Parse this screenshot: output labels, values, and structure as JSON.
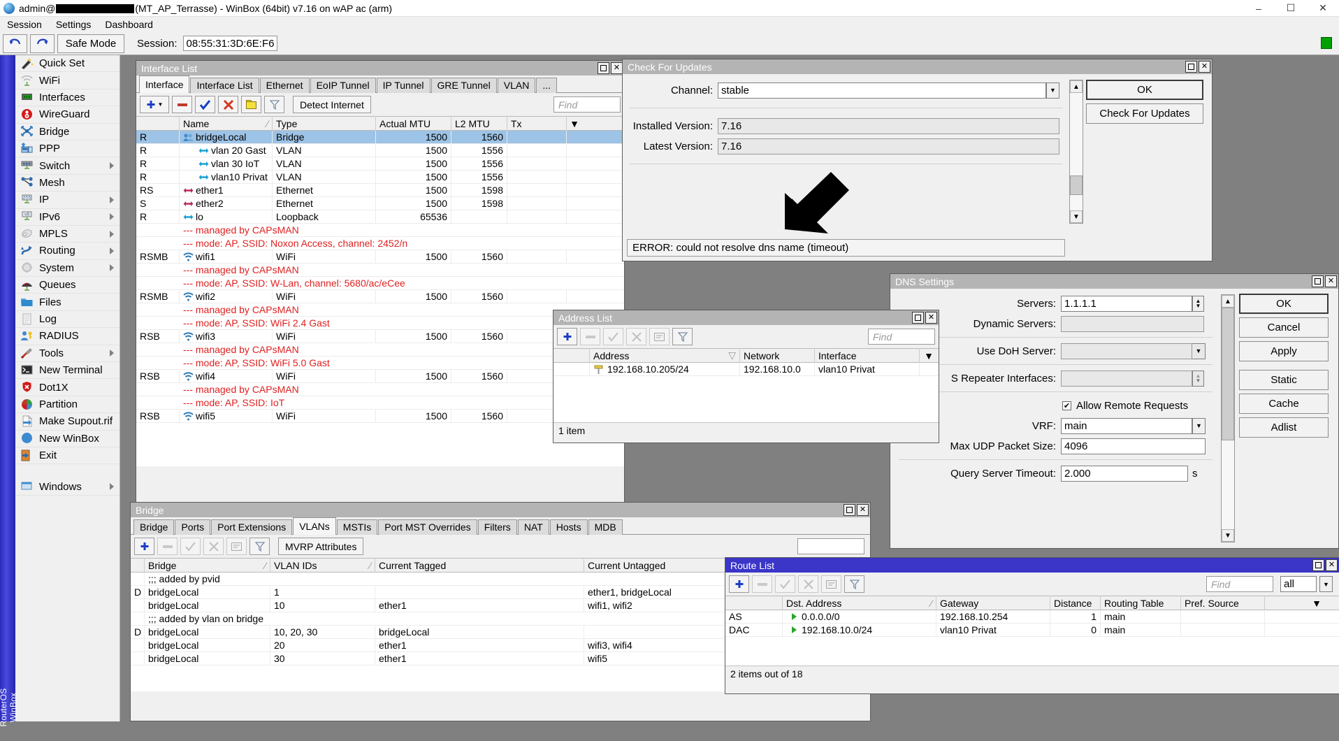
{
  "titlebar": {
    "prefix": "admin@",
    "suffix": "(MT_AP_Terrasse) - WinBox (64bit) v7.16 on wAP ac (arm)",
    "minimize": "–",
    "maximize": "☐",
    "close": "✕"
  },
  "menubar": {
    "items": [
      "Session",
      "Settings",
      "Dashboard"
    ]
  },
  "toolbar": {
    "undo": "↶",
    "redo": "↷",
    "safe_mode": "Safe Mode",
    "session_label": "Session:",
    "session_value": "08:55:31:3D:6E:F6"
  },
  "sidebar": {
    "vertical_label": "RouterOS WinBox",
    "items": [
      {
        "label": "Quick Set",
        "icon": "wand-icon",
        "arrow": false
      },
      {
        "label": "WiFi",
        "icon": "wifi-icon",
        "arrow": false
      },
      {
        "label": "Interfaces",
        "icon": "interfaces-icon",
        "arrow": false
      },
      {
        "label": "WireGuard",
        "icon": "wireguard-icon",
        "arrow": false
      },
      {
        "label": "Bridge",
        "icon": "bridge-icon",
        "arrow": false
      },
      {
        "label": "PPP",
        "icon": "ppp-icon",
        "arrow": false
      },
      {
        "label": "Switch",
        "icon": "switch-icon",
        "arrow": true
      },
      {
        "label": "Mesh",
        "icon": "mesh-icon",
        "arrow": false
      },
      {
        "label": "IP",
        "icon": "ip-icon",
        "arrow": true
      },
      {
        "label": "IPv6",
        "icon": "ipv6-icon",
        "arrow": true
      },
      {
        "label": "MPLS",
        "icon": "mpls-icon",
        "arrow": true
      },
      {
        "label": "Routing",
        "icon": "routing-icon",
        "arrow": true
      },
      {
        "label": "System",
        "icon": "system-icon",
        "arrow": true
      },
      {
        "label": "Queues",
        "icon": "queues-icon",
        "arrow": false
      },
      {
        "label": "Files",
        "icon": "files-icon",
        "arrow": false
      },
      {
        "label": "Log",
        "icon": "log-icon",
        "arrow": false
      },
      {
        "label": "RADIUS",
        "icon": "radius-icon",
        "arrow": false
      },
      {
        "label": "Tools",
        "icon": "tools-icon",
        "arrow": true
      },
      {
        "label": "New Terminal",
        "icon": "terminal-icon",
        "arrow": false
      },
      {
        "label": "Dot1X",
        "icon": "dot1x-icon",
        "arrow": false
      },
      {
        "label": "Partition",
        "icon": "partition-icon",
        "arrow": false
      },
      {
        "label": "Make Supout.rif",
        "icon": "supout-icon",
        "arrow": false
      },
      {
        "label": "New WinBox",
        "icon": "winbox-icon",
        "arrow": false
      },
      {
        "label": "Exit",
        "icon": "exit-icon",
        "arrow": false
      },
      {
        "label": "",
        "icon": "",
        "arrow": false
      },
      {
        "label": "Windows",
        "icon": "windows-icon",
        "arrow": true
      }
    ]
  },
  "interface_list": {
    "title": "Interface List",
    "tabs": [
      "Interface",
      "Interface List",
      "Ethernet",
      "EoIP Tunnel",
      "IP Tunnel",
      "GRE Tunnel",
      "VLAN",
      "..."
    ],
    "selected_tab": "Interface",
    "toolbar": {
      "add": "＋",
      "add_caret": "▾",
      "remove": "–",
      "enable": "✔",
      "disable": "✘",
      "comment": "▭",
      "filter": "∇",
      "detect": "Detect Internet"
    },
    "find_placeholder": "Find",
    "columns": [
      "",
      "Name",
      "Type",
      "Actual MTU",
      "L2 MTU",
      "Tx",
      ""
    ],
    "rows": [
      {
        "kind": "row",
        "flags": "R",
        "icon": "bridge-row-icon",
        "indent": 0,
        "name": "bridgeLocal",
        "type": "Bridge",
        "mtu": "1500",
        "l2mtu": "1560",
        "tx": "",
        "selected": true
      },
      {
        "kind": "row",
        "flags": "R",
        "icon": "vlan-row-icon",
        "indent": 1,
        "name": "vlan 20 Gast",
        "type": "VLAN",
        "mtu": "1500",
        "l2mtu": "1556",
        "tx": ""
      },
      {
        "kind": "row",
        "flags": "R",
        "icon": "vlan-row-icon",
        "indent": 1,
        "name": "vlan 30 IoT",
        "type": "VLAN",
        "mtu": "1500",
        "l2mtu": "1556",
        "tx": ""
      },
      {
        "kind": "row",
        "flags": "R",
        "icon": "vlan-row-icon",
        "indent": 1,
        "name": "vlan10 Privat",
        "type": "VLAN",
        "mtu": "1500",
        "l2mtu": "1556",
        "tx": ""
      },
      {
        "kind": "row",
        "flags": "RS",
        "icon": "ether-row-icon",
        "indent": 0,
        "name": "ether1",
        "type": "Ethernet",
        "mtu": "1500",
        "l2mtu": "1598",
        "tx": ""
      },
      {
        "kind": "row",
        "flags": "S",
        "icon": "ether-row-icon",
        "indent": 0,
        "name": "ether2",
        "type": "Ethernet",
        "mtu": "1500",
        "l2mtu": "1598",
        "tx": ""
      },
      {
        "kind": "row",
        "flags": "R",
        "icon": "vlan-row-icon",
        "indent": 0,
        "name": "lo",
        "type": "Loopback",
        "mtu": "65536",
        "l2mtu": "",
        "tx": ""
      },
      {
        "kind": "comment",
        "text": "--- managed by CAPsMAN"
      },
      {
        "kind": "comment",
        "text": "--- mode: AP, SSID: Noxon Access, channel: 2452/n"
      },
      {
        "kind": "row",
        "flags": "RSMB",
        "icon": "wifi-row-icon",
        "indent": 0,
        "name": "wifi1",
        "type": "WiFi",
        "mtu": "1500",
        "l2mtu": "1560",
        "tx": ""
      },
      {
        "kind": "comment",
        "text": "--- managed by CAPsMAN"
      },
      {
        "kind": "comment",
        "text": "--- mode: AP, SSID: W-Lan, channel: 5680/ac/eCee"
      },
      {
        "kind": "row",
        "flags": "RSMB",
        "icon": "wifi-row-icon",
        "indent": 0,
        "name": "wifi2",
        "type": "WiFi",
        "mtu": "1500",
        "l2mtu": "1560",
        "tx": ""
      },
      {
        "kind": "comment",
        "text": "--- managed by CAPsMAN"
      },
      {
        "kind": "comment",
        "text": "--- mode: AP, SSID: WiFi 2.4 Gast"
      },
      {
        "kind": "row",
        "flags": "RSB",
        "icon": "wifi-row-icon",
        "indent": 0,
        "name": "wifi3",
        "type": "WiFi",
        "mtu": "1500",
        "l2mtu": "1560",
        "tx": ""
      },
      {
        "kind": "comment",
        "text": "--- managed by CAPsMAN"
      },
      {
        "kind": "comment",
        "text": "--- mode: AP, SSID: WiFi 5.0 Gast"
      },
      {
        "kind": "row",
        "flags": "RSB",
        "icon": "wifi-row-icon",
        "indent": 0,
        "name": "wifi4",
        "type": "WiFi",
        "mtu": "1500",
        "l2mtu": "1560",
        "tx": ""
      },
      {
        "kind": "comment",
        "text": "--- managed by CAPsMAN"
      },
      {
        "kind": "comment",
        "text": "--- mode: AP, SSID: IoT"
      },
      {
        "kind": "row",
        "flags": "RSB",
        "icon": "wifi-row-icon",
        "indent": 0,
        "name": "wifi5",
        "type": "WiFi",
        "mtu": "1500",
        "l2mtu": "1560",
        "tx": ""
      }
    ]
  },
  "check_updates": {
    "title": "Check For Updates",
    "channel_label": "Channel:",
    "channel_value": "stable",
    "installed_label": "Installed Version:",
    "installed_value": "7.16",
    "latest_label": "Latest Version:",
    "latest_value": "7.16",
    "error_text": "ERROR: could not resolve dns name (timeout)",
    "ok_button": "OK",
    "check_button": "Check For Updates"
  },
  "address_list": {
    "title": "Address List",
    "find_placeholder": "Find",
    "columns": [
      "",
      "Address",
      "Network",
      "Interface",
      ""
    ],
    "rows": [
      {
        "flag": "",
        "address": "192.168.10.205/24",
        "network": "192.168.10.0",
        "interface": "vlan10 Privat"
      }
    ],
    "status": "1 item"
  },
  "dns_settings": {
    "title": "DNS Settings",
    "fields": [
      {
        "label": "Servers:",
        "value": "1.1.1.1",
        "widget": "spinner",
        "readonly": false
      },
      {
        "label": "Dynamic Servers:",
        "value": "",
        "widget": "none",
        "readonly": true
      },
      {
        "label": "Use DoH Server:",
        "value": "",
        "widget": "dropdown",
        "readonly": false
      },
      {
        "label": "S Repeater Interfaces:",
        "value": "",
        "widget": "spinner",
        "readonly": false
      }
    ],
    "checkbox_label": "Allow Remote Requests",
    "checkbox_checked": true,
    "vrf_label": "VRF:",
    "vrf_value": "main",
    "maxudp_label": "Max UDP Packet Size:",
    "maxudp_value": "4096",
    "timeout_label": "Query Server Timeout:",
    "timeout_value": "2.000",
    "timeout_unit": "s",
    "buttons": [
      "OK",
      "Cancel",
      "Apply",
      "Static",
      "Cache",
      "Adlist"
    ]
  },
  "bridge": {
    "title": "Bridge",
    "tabs": [
      "Bridge",
      "Ports",
      "Port Extensions",
      "VLANs",
      "MSTIs",
      "Port MST Overrides",
      "Filters",
      "NAT",
      "Hosts",
      "MDB"
    ],
    "selected_tab": "VLANs",
    "mvrp_button": "MVRP Attributes",
    "columns": [
      "",
      "Bridge",
      "VLAN IDs",
      "Current Tagged",
      "Current Untagged"
    ],
    "rows": [
      {
        "kind": "comment",
        "text": ";;; added by pvid"
      },
      {
        "kind": "row",
        "flags": "D",
        "bridge": "bridgeLocal",
        "vlan_ids": "1",
        "tagged": "",
        "untagged": "ether1, bridgeLocal"
      },
      {
        "kind": "row",
        "flags": "",
        "bridge": "bridgeLocal",
        "vlan_ids": "10",
        "tagged": "ether1",
        "untagged": "wifi1, wifi2"
      },
      {
        "kind": "comment",
        "text": ";;; added by vlan on bridge"
      },
      {
        "kind": "row",
        "flags": "D",
        "bridge": "bridgeLocal",
        "vlan_ids": "10, 20, 30",
        "tagged": "bridgeLocal",
        "untagged": ""
      },
      {
        "kind": "row",
        "flags": "",
        "bridge": "bridgeLocal",
        "vlan_ids": "20",
        "tagged": "ether1",
        "untagged": "wifi3, wifi4"
      },
      {
        "kind": "row",
        "flags": "",
        "bridge": "bridgeLocal",
        "vlan_ids": "30",
        "tagged": "ether1",
        "untagged": "wifi5"
      }
    ]
  },
  "route_list": {
    "title": "Route List",
    "find_placeholder": "Find",
    "filter_value": "all",
    "columns": [
      "",
      "Dst. Address",
      "Gateway",
      "Distance",
      "Routing Table",
      "Pref. Source",
      ""
    ],
    "rows": [
      {
        "flags": "AS",
        "dst": "0.0.0.0/0",
        "gateway": "192.168.10.254",
        "distance": "1",
        "table": "main",
        "pref": ""
      },
      {
        "flags": "DAC",
        "dst": "192.168.10.0/24",
        "gateway": "vlan10 Privat",
        "distance": "0",
        "table": "main",
        "pref": ""
      }
    ],
    "status": "2 items out of 18"
  },
  "colors": {
    "accent_blue": "#3b35c8",
    "inactive_title": "#b4b4b4",
    "selection": "#9dc3e6",
    "comment_red": "#e02020",
    "desktop": "#808080"
  }
}
